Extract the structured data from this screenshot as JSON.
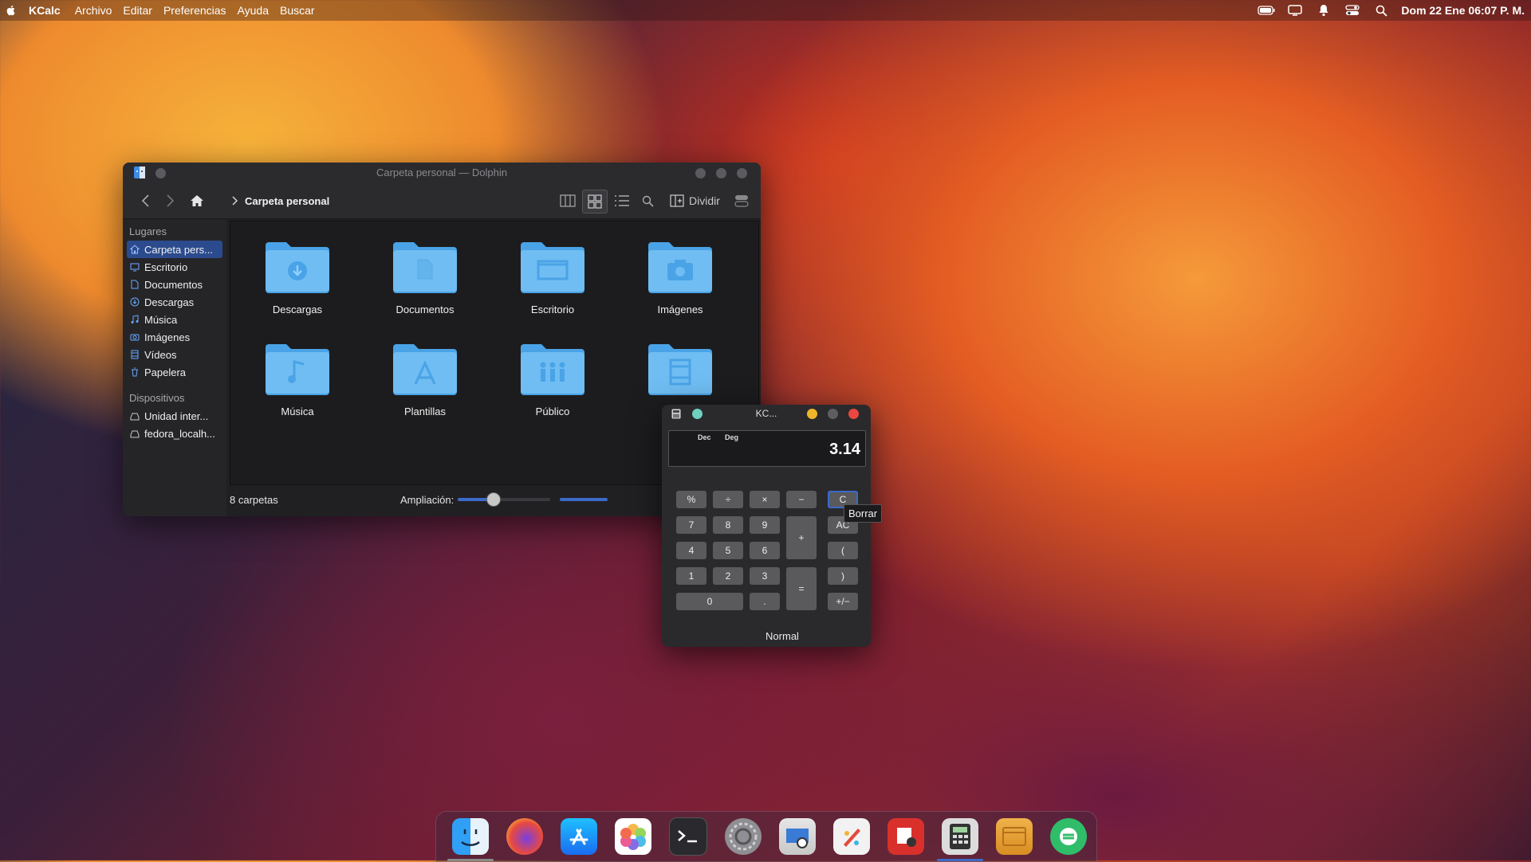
{
  "menubar": {
    "app_name": "KCalc",
    "items": [
      "Archivo",
      "Editar",
      "Preferencias",
      "Ayuda",
      "Buscar"
    ],
    "clock": "Dom 22 Ene  06:07 P. M."
  },
  "dolphin": {
    "title": "Carpeta personal — Dolphin",
    "breadcrumb": "Carpeta personal",
    "split_label": "Dividir",
    "sidebar": {
      "places_header": "Lugares",
      "places": [
        {
          "label": "Carpeta pers...",
          "icon": "home-icon",
          "active": true
        },
        {
          "label": "Escritorio",
          "icon": "desktop-icon"
        },
        {
          "label": "Documentos",
          "icon": "documents-icon"
        },
        {
          "label": "Descargas",
          "icon": "downloads-icon"
        },
        {
          "label": "Música",
          "icon": "music-icon"
        },
        {
          "label": "Imágenes",
          "icon": "pictures-icon"
        },
        {
          "label": "Vídeos",
          "icon": "videos-icon"
        },
        {
          "label": "Papelera",
          "icon": "trash-icon"
        }
      ],
      "devices_header": "Dispositivos",
      "devices": [
        {
          "label": "Unidad inter...",
          "icon": "drive-icon"
        },
        {
          "label": "fedora_localh...",
          "icon": "drive-icon"
        }
      ]
    },
    "folders": [
      {
        "name": "Descargas",
        "icon": "download-folder-icon"
      },
      {
        "name": "Documentos",
        "icon": "document-folder-icon"
      },
      {
        "name": "Escritorio",
        "icon": "desktop-folder-icon"
      },
      {
        "name": "Imágenes",
        "icon": "camera-folder-icon"
      },
      {
        "name": "Música",
        "icon": "music-folder-icon"
      },
      {
        "name": "Plantillas",
        "icon": "templates-folder-icon"
      },
      {
        "name": "Público",
        "icon": "public-folder-icon"
      },
      {
        "name": "",
        "icon": "video-folder-icon"
      }
    ],
    "status": {
      "count": "8 carpetas",
      "zoom_label": "Ampliación:",
      "zoom_level": 0.38
    }
  },
  "kcalc": {
    "title": "KC...",
    "flag_dec": "Dec",
    "flag_deg": "Deg",
    "display_value": "3.14",
    "buttons": {
      "percent": "%",
      "divide": "÷",
      "multiply": "×",
      "minus": "−",
      "clear": "C",
      "seven": "7",
      "eight": "8",
      "nine": "9",
      "plus": "+",
      "all_clear": "AC",
      "four": "4",
      "five": "5",
      "six": "6",
      "open_paren": "(",
      "one": "1",
      "two": "2",
      "three": "3",
      "equals": "=",
      "close_paren": ")",
      "zero": "0",
      "decimal": ".",
      "sign": "+/−"
    },
    "mode": "Normal",
    "tooltip": "Borrar"
  },
  "dock": {
    "apps": [
      "finder-icon",
      "firefox-icon",
      "app-store-icon",
      "photos-icon",
      "terminal-icon",
      "system-settings-icon",
      "image-viewer-icon",
      "paint-icon",
      "screenshot-icon",
      "calculator-icon",
      "archive-icon",
      "transfer-icon"
    ]
  }
}
